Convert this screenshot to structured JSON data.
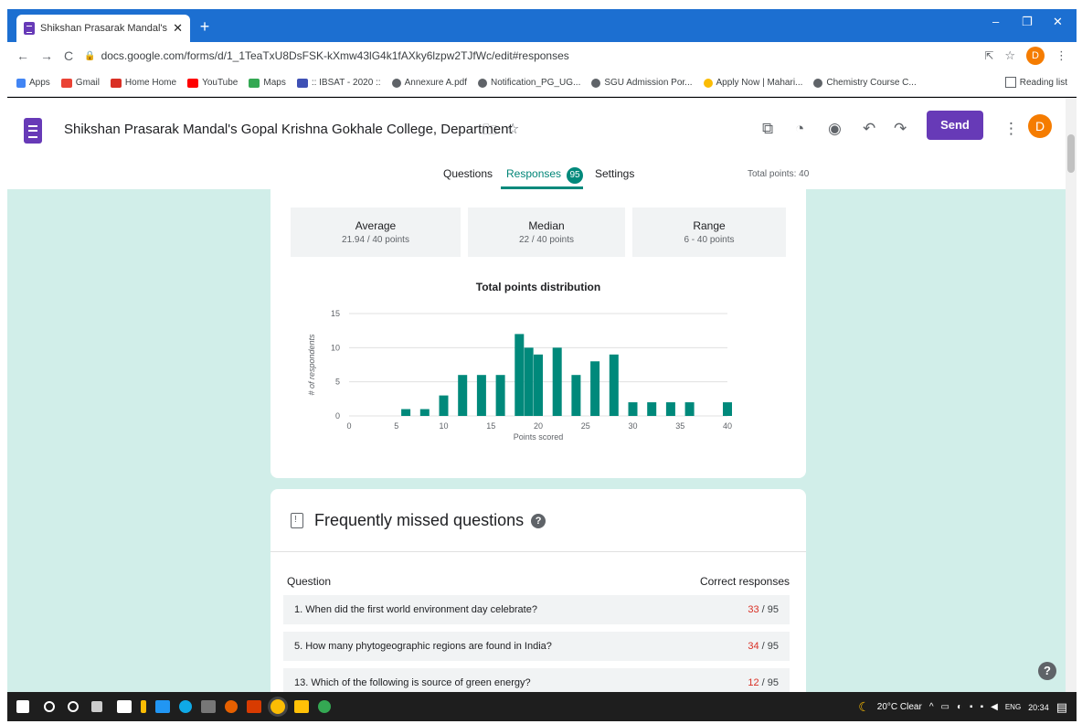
{
  "browser": {
    "tab_title": "Shikshan Prasarak Mandal's Gop",
    "tab_close": "✕",
    "url": "docs.google.com/forms/d/1_1TeaTxU8DsFSK-kXmw43lG4k1fAXky6lzpw2TJfWc/edit#responses",
    "profile_initial": "D",
    "bookmarks": [
      {
        "label": "Apps",
        "color": "#ea4335"
      },
      {
        "label": "Gmail",
        "color": "#ea4335"
      },
      {
        "label": "Home Home",
        "color": "#d93025"
      },
      {
        "label": "YouTube",
        "color": "#ff0000"
      },
      {
        "label": "Maps",
        "color": "#34a853"
      },
      {
        "label": ":: IBSAT - 2020 ::",
        "color": "#3f51b5"
      },
      {
        "label": "Annexure A.pdf",
        "color": "#5f6368"
      },
      {
        "label": "Notification_PG_UG...",
        "color": "#5f6368"
      },
      {
        "label": "SGU Admission Por...",
        "color": "#5f6368"
      },
      {
        "label": "Apply Now | Mahari...",
        "color": "#fbbc04"
      },
      {
        "label": "Chemistry Course C...",
        "color": "#5f6368"
      }
    ],
    "reading_list": "Reading list"
  },
  "form": {
    "title": "Shikshan Prasarak Mandal's Gopal Krishna Gokhale College, Department",
    "send_label": "Send",
    "avatar_initial": "D",
    "tabs": [
      {
        "label": "Questions"
      },
      {
        "label": "Responses"
      },
      {
        "label": "Settings"
      }
    ],
    "responses_count": "95",
    "total_points": "Total points: 40"
  },
  "stats": [
    {
      "label": "Average",
      "value": "21.94 / 40 points"
    },
    {
      "label": "Median",
      "value": "22 / 40 points"
    },
    {
      "label": "Range",
      "value": "6 - 40 points"
    }
  ],
  "chart_data": {
    "type": "bar",
    "title": "Total points distribution",
    "xlabel": "Points scored",
    "ylabel": "# of respondents",
    "x": [
      6,
      8,
      10,
      12,
      14,
      16,
      18,
      19,
      20,
      22,
      24,
      26,
      28,
      30,
      32,
      34,
      36,
      40
    ],
    "values": [
      1,
      1,
      3,
      6,
      6,
      6,
      12,
      10,
      9,
      10,
      6,
      8,
      9,
      2,
      2,
      2,
      2,
      2
    ],
    "xlim": [
      0,
      40
    ],
    "ylim": [
      0,
      15
    ],
    "xticks": [
      0,
      5,
      10,
      15,
      20,
      25,
      30,
      35,
      40
    ],
    "yticks": [
      0,
      5,
      10,
      15
    ],
    "color": "#00897b",
    "grid": true
  },
  "missed": {
    "title": "Frequently missed questions",
    "col_question": "Question",
    "col_correct": "Correct responses",
    "rows": [
      {
        "question": "1. When did the first world environment day celebrate?",
        "correct": "33",
        "total": " / 95"
      },
      {
        "question": "5. How many phytogeographic regions are found in India?",
        "correct": "34",
        "total": " / 95"
      },
      {
        "question": "13. Which of the following is source of green energy?",
        "correct": "12",
        "total": " / 95"
      }
    ]
  },
  "taskbar": {
    "weather": "20°C  Clear",
    "lang": "ENG",
    "time": "20:34"
  }
}
